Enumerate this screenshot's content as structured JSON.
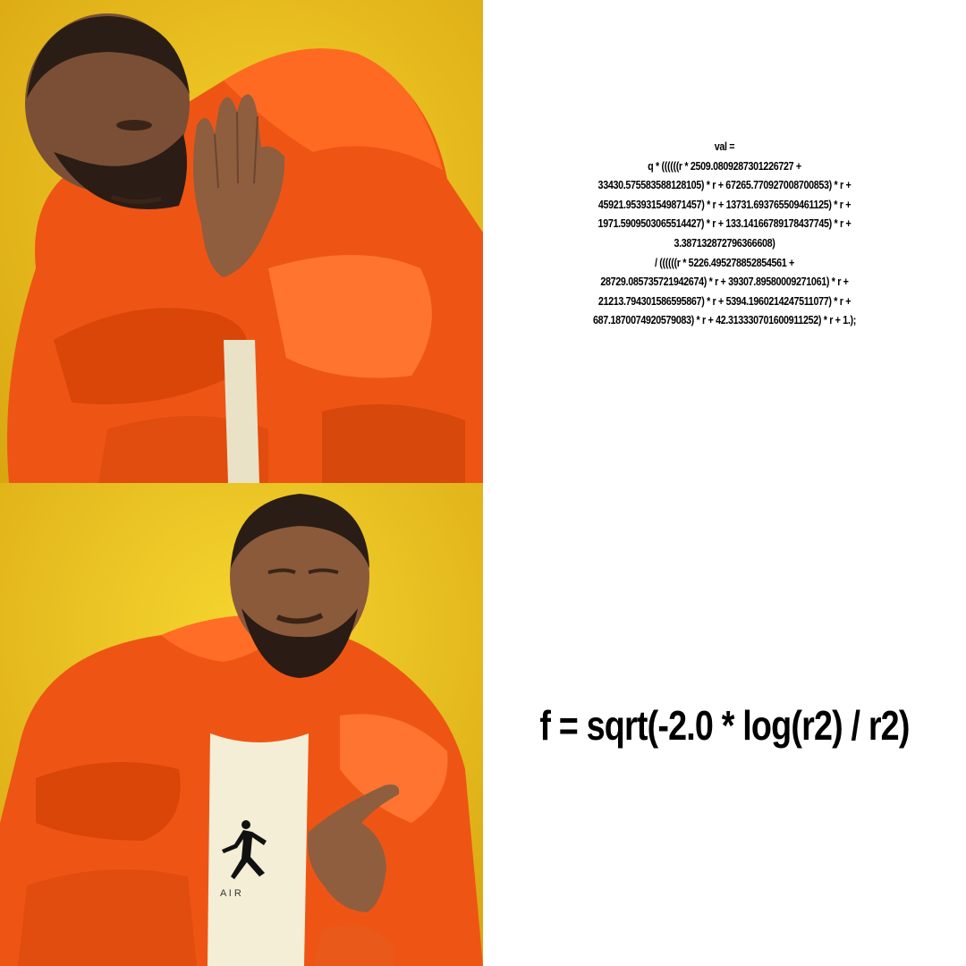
{
  "meme": {
    "top": {
      "gesture": "reject",
      "code": "val =\nq * ((((((r * 2509.0809287301226727 +\n33430.575583588128105) * r + 67265.770927008700853) * r +\n45921.953931549871457) * r + 13731.693765509461125) * r +\n1971.5909503065514427) * r + 133.14166789178437745) * r +\n3.387132872796366608)\n/ ((((((r * 5226.495278852854561 +\n28729.085735721942674) * r + 39307.89580009271061) * r +\n21213.794301586595867) * r + 5394.1960214247511077) * r +\n687.1870074920579083) * r + 42.313330701600911252) * r + 1.);"
    },
    "bottom": {
      "gesture": "approve",
      "code": "f = sqrt(-2.0 * log(r2) / r2)",
      "shirt_text": "A I R"
    }
  },
  "colors": {
    "background_yellow": "#e6b81a",
    "jacket_orange": "#f05a14",
    "text": "#000000",
    "panel_white": "#ffffff"
  },
  "icons": [
    "disapproving-hand-icon",
    "pointing-hand-icon",
    "jumpman-logo-icon"
  ]
}
